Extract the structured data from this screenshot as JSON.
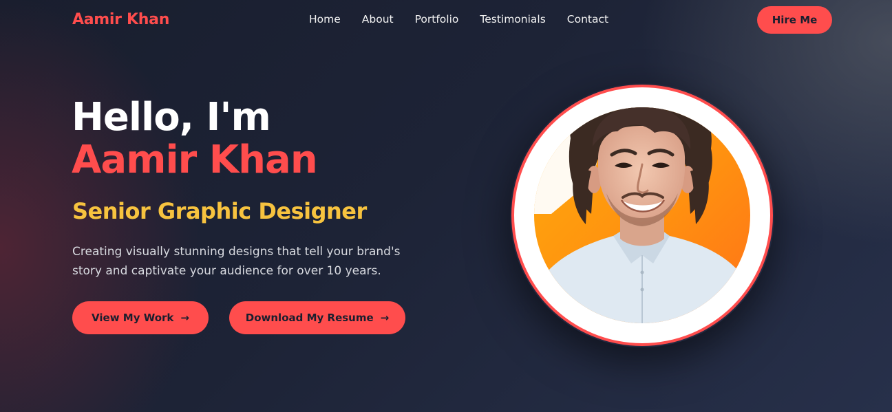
{
  "nav": {
    "brand": "Aamir Khan",
    "items": [
      {
        "label": "Home"
      },
      {
        "label": "About"
      },
      {
        "label": "Portfolio"
      },
      {
        "label": "Testimonials"
      },
      {
        "label": "Contact"
      }
    ],
    "cta_label": "Hire Me"
  },
  "hero": {
    "greeting": "Hello, I'm",
    "name": "Aamir Khan",
    "role": "Senior Graphic Designer",
    "description": "Creating visually stunning designs that tell your brand's story and captivate your audience for over 10 years.",
    "primary_button": "View My Work",
    "secondary_button": "Download My Resume",
    "arrow_icon": "→"
  },
  "icons": {
    "button_arrow": "arrow-right-icon",
    "portrait": "profile-photo"
  },
  "colors": {
    "accent": "#ff4d4d",
    "role_text": "#f7c33f",
    "background": "#1d2336",
    "portrait_bg_orange": "#ff9a12",
    "portrait_ring": "#ffffff"
  }
}
